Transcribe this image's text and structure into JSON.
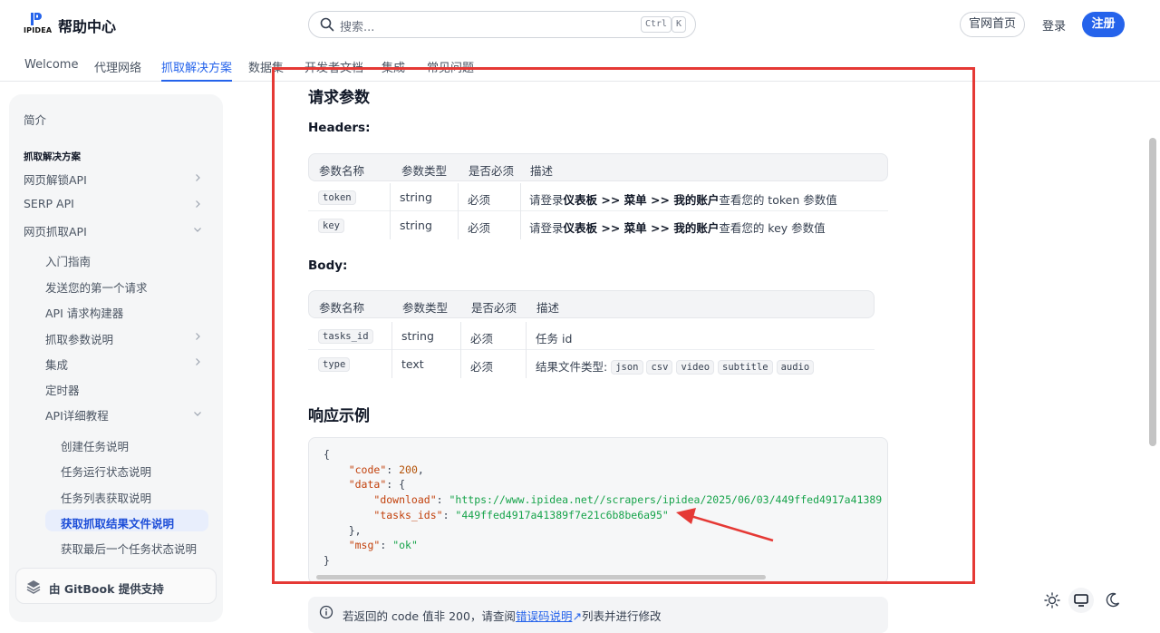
{
  "header": {
    "logo_text": "IPIDEA",
    "site_title": "帮助中心",
    "search_placeholder": "搜索...",
    "kbd_ctrl": "Ctrl",
    "kbd_k": "K",
    "home_button": "官网首页",
    "login_button": "登录",
    "register_button": "注册"
  },
  "tabs": [
    {
      "label": "Welcome"
    },
    {
      "label": "代理网络"
    },
    {
      "label": "抓取解决方案"
    },
    {
      "label": "数据集"
    },
    {
      "label": "开发者文档"
    },
    {
      "label": "集成"
    },
    {
      "label": "常见问题"
    }
  ],
  "sidebar": {
    "intro": "简介",
    "section_title": "抓取解决方案",
    "items": [
      {
        "label": "网页解锁API"
      },
      {
        "label": "SERP API"
      },
      {
        "label": "网页抓取API"
      },
      {
        "label": "入门指南"
      },
      {
        "label": "发送您的第一个请求"
      },
      {
        "label": "API 请求构建器"
      },
      {
        "label": "抓取参数说明"
      },
      {
        "label": "集成"
      },
      {
        "label": "定时器"
      },
      {
        "label": "API详细教程"
      },
      {
        "label": "创建任务说明"
      },
      {
        "label": "任务运行状态说明"
      },
      {
        "label": "任务列表获取说明"
      },
      {
        "label": "获取抓取结果文件说明"
      },
      {
        "label": "获取最后一个任务状态说明"
      }
    ],
    "footer": "由 GitBook 提供支持"
  },
  "content": {
    "request_params_title": "请求参数",
    "headers_title": "Headers:",
    "body_title": "Body:",
    "table_headers": [
      "参数名称",
      "参数类型",
      "是否必须",
      "描述"
    ],
    "headers_rows": [
      {
        "name": "token",
        "type": "string",
        "required": "必须",
        "desc_pre": "请登录",
        "desc_bold": "仪表板 >> 菜单 >> 我的账户",
        "desc_post": "查看您的 token 参数值"
      },
      {
        "name": "key",
        "type": "string",
        "required": "必须",
        "desc_pre": "请登录",
        "desc_bold": "仪表板 >> 菜单 >> 我的账户",
        "desc_post": "查看您的 key 参数值"
      }
    ],
    "body_rows": [
      {
        "name": "tasks_id",
        "type": "string",
        "required": "必须",
        "desc": "任务 id"
      },
      {
        "name": "type",
        "type": "text",
        "required": "必须",
        "desc": "结果文件类型:"
      }
    ],
    "file_types": [
      "json",
      "csv",
      "video",
      "subtitle",
      "audio"
    ],
    "response_title": "响应示例",
    "code": {
      "open": "{",
      "code_key": "\"code\"",
      "code_val": "200",
      "data_key": "\"data\"",
      "download_key": "\"download\"",
      "download_val": "\"https://www.ipidea.net//scrapers/ipidea/2025/06/03/449ffed4917a41389",
      "tasks_ids_key": "\"tasks_ids\"",
      "tasks_ids_val": "\"449ffed4917a41389f7e21c6b8be6a95\"",
      "data_close": "},",
      "msg_key": "\"msg\"",
      "msg_val": "\"ok\"",
      "close": "}"
    },
    "hint_pre": "若返回的 code 值非 200，请查阅",
    "hint_link": "错误码说明",
    "hint_post": "列表并进行修改"
  },
  "colors": {
    "accent": "#2563eb",
    "annotation": "#e53935"
  }
}
